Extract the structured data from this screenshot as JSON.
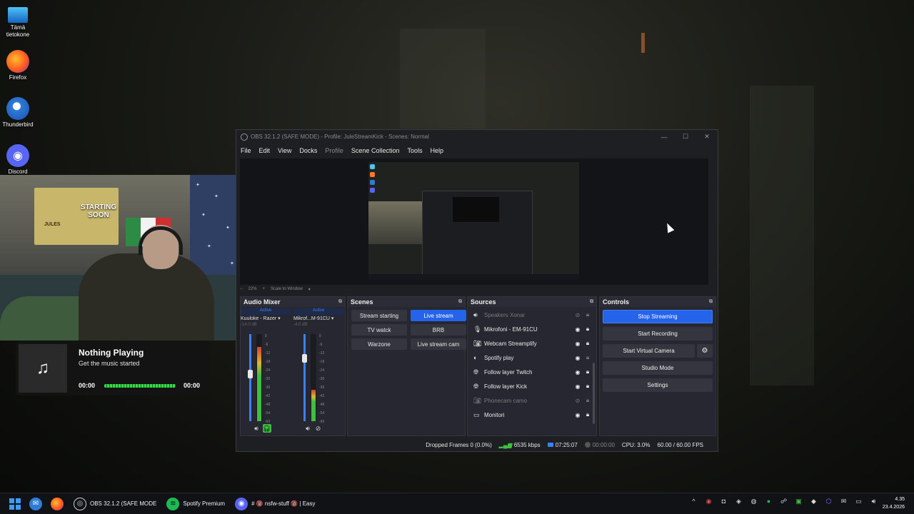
{
  "desktop": {
    "icons": [
      {
        "label_line1": "Tämä",
        "label_line2": "tietokone",
        "icon": "monitor-icon"
      },
      {
        "label_line1": "Firefox",
        "label_line2": "",
        "icon": "firefox-icon"
      },
      {
        "label_line1": "Thunderbird",
        "label_line2": "",
        "icon": "thunderbird-icon"
      },
      {
        "label_line1": "Discord",
        "label_line2": "",
        "icon": "discord-icon"
      }
    ]
  },
  "webcam": {
    "poster_text": "STARTING SOON",
    "poster_small": "JULES"
  },
  "now_playing": {
    "title": "Nothing Playing",
    "subtitle": "Get the music started",
    "time_start": "00:00",
    "time_end": "00:00",
    "progress": 1.0
  },
  "obs": {
    "title": "OBS 32.1.2 (SAFE MODE) - Profile: JuleStreamKick - Scenes: Normal",
    "menu": [
      "File",
      "Edit",
      "View",
      "Docks",
      "Profile",
      "Scene Collection",
      "Tools",
      "Help"
    ],
    "zoom": {
      "minus": "−",
      "value": "22%",
      "plus": "+",
      "scale": "Scale to Window"
    },
    "audio_mixer": {
      "title": "Audio Mixer",
      "channels": [
        {
          "status": "Active",
          "name": "Kuuloke - Razer",
          "db": "-14.0 dB",
          "level": 0.85,
          "fader": 0.55
        },
        {
          "status": "Active",
          "name": "Mikrof...M-91CU",
          "db": "-4.0 dB",
          "level": 0.36,
          "fader": 0.75
        }
      ],
      "scale": [
        "0",
        "-6",
        "-12",
        "-18",
        "-24",
        "-30",
        "-36",
        "-42",
        "-48",
        "-54",
        "-60"
      ]
    },
    "scenes": {
      "title": "Scenes",
      "items": [
        "Stream starting",
        "Live stream",
        "TV watck",
        "BRB",
        "Warzone",
        "Live stream cam"
      ],
      "selected": "Live stream"
    },
    "sources": {
      "title": "Sources",
      "items": [
        {
          "name": "Speakers Xonar",
          "icon": "speaker-icon",
          "visible": false
        },
        {
          "name": "Mikrofoni - EM-91CU",
          "icon": "microphone-icon",
          "visible": true
        },
        {
          "name": "Webcam Streamplify",
          "icon": "camera-icon",
          "visible": true
        },
        {
          "name": "Spotify play",
          "icon": "window-capture-icon",
          "visible": true
        },
        {
          "name": "Follow layer Twitch",
          "icon": "browser-icon",
          "visible": true
        },
        {
          "name": "Follow layer Kick",
          "icon": "browser-icon",
          "visible": true
        },
        {
          "name": "Phonecam camo",
          "icon": "camera-icon",
          "visible": false
        },
        {
          "name": "Monitori",
          "icon": "display-capture-icon",
          "visible": true
        }
      ]
    },
    "controls": {
      "title": "Controls",
      "stop_streaming": "Stop Streaming",
      "start_recording": "Start Recording",
      "start_virtual_camera": "Start Virtual Camera",
      "studio_mode": "Studio Mode",
      "settings": "Settings"
    },
    "status": {
      "dropped_frames": "Dropped Frames 0 (0.0%)",
      "bitrate": "6535 kbps",
      "live_time": "07:25:07",
      "rec_time": "00:00:00",
      "cpu": "CPU: 3.0%",
      "fps": "60.00 / 60.00 FPS"
    }
  },
  "taskbar": {
    "apps": [
      {
        "label": "OBS 32.1.2 (SAFE MODE",
        "icon": "obs-icon"
      },
      {
        "label": "Spotify Premium",
        "icon": "spotify-icon"
      },
      {
        "label": "# 🔞 nsfw-stuff 🔞 | Easy",
        "icon": "discord-icon"
      }
    ],
    "clock_time": "4.35",
    "clock_date": "23.4.2026"
  },
  "colors": {
    "accent": "#2563eb",
    "meter_green": "#3fbf40",
    "spotify_green": "#1db954"
  }
}
